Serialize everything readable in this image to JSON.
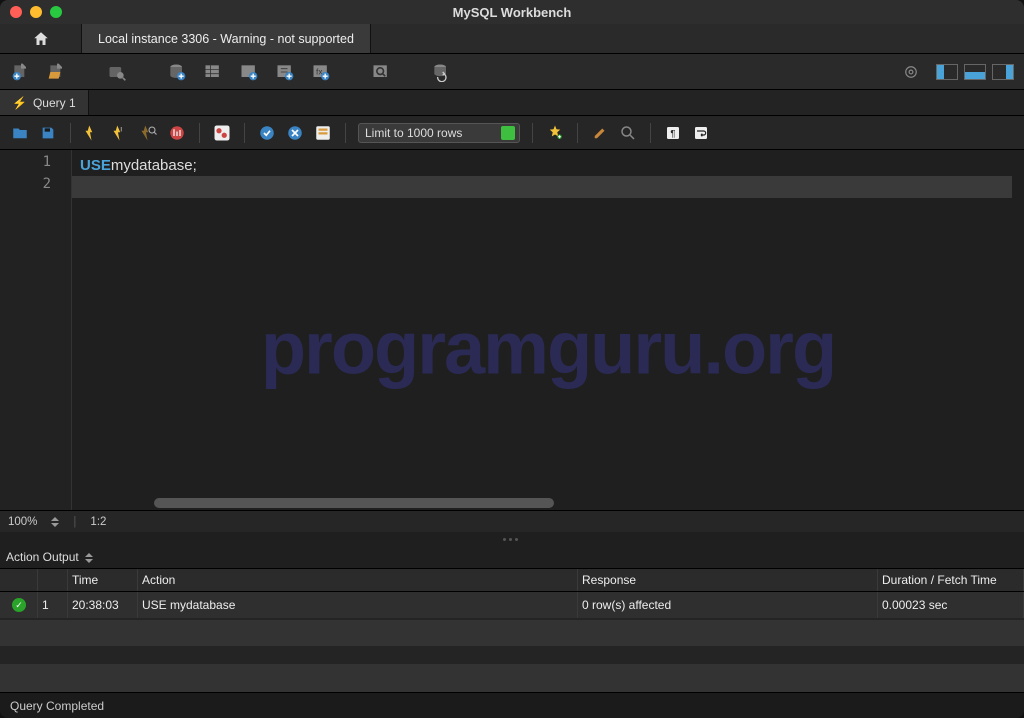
{
  "app_title": "MySQL Workbench",
  "connection_tab": "Local instance 3306 - Warning - not supported",
  "query_tab": "Query 1",
  "limit_label": "Limit to 1000 rows",
  "editor": {
    "lines": [
      "1",
      "2"
    ],
    "kw": "USE",
    "ident": " mydatabase",
    "punct": ";"
  },
  "watermark": "programguru.org",
  "status": {
    "zoom": "100%",
    "cursor": "1:2"
  },
  "action_output_label": "Action Output",
  "grid": {
    "headers": {
      "time": "Time",
      "action": "Action",
      "response": "Response",
      "duration": "Duration / Fetch Time"
    },
    "row": {
      "index": "1",
      "time": "20:38:03",
      "action": "USE mydatabase",
      "response": "0 row(s) affected",
      "duration": "0.00023 sec"
    }
  },
  "footer": "Query Completed"
}
